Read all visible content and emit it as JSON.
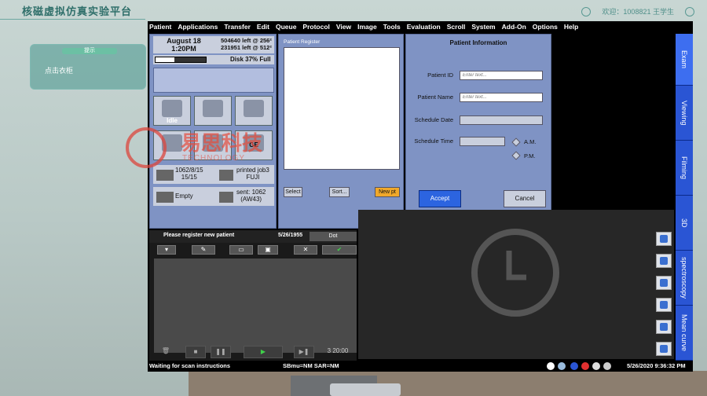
{
  "platform": {
    "title": "核磁虚拟仿真实验平台",
    "user_id": "1008821",
    "welcome": "欢迎：",
    "user_name": "王学生",
    "panel_tab": "提示",
    "panel_text": "点击衣柜"
  },
  "menu": [
    "Patient",
    "Applications",
    "Transfer",
    "Edit",
    "Queue",
    "Protocol",
    "View",
    "Image",
    "Tools",
    "Evaluation",
    "Scroll",
    "System",
    "Add-On",
    "Options",
    "Help"
  ],
  "status": {
    "date": "August 18",
    "time": "1:20PM",
    "space1": "504640 left @ 256²",
    "space2": "231951 left @ 512²",
    "disk_label": "Disk 37% Full",
    "disk_percent": 37,
    "idle_label": "Idle",
    "ge_label": "GE",
    "row1_left": "1062/8/15",
    "row1_left2": "15/15",
    "row1_right": "printed job3",
    "row1_right2": "FUJI",
    "row2_left": "Empty",
    "row2_right": "sent: 1062",
    "row2_right2": "(AW43)"
  },
  "register": {
    "title": "Patient Register",
    "select_label": "Select",
    "sort_label": "Sort...",
    "newpt_label": "New pt"
  },
  "patient_info": {
    "title": "Patient Information",
    "id_label": "Patient ID",
    "id_placeholder": "Enter text...",
    "name_label": "Patient Name",
    "name_placeholder": "Enter text...",
    "date_label": "Schedule Date",
    "time_label": "Schedule Time",
    "am_label": "A.M.",
    "pm_label": "P.M.",
    "accept_label": "Accept",
    "cancel_label": "Cancel"
  },
  "right_tabs": [
    "Exam",
    "Viewing",
    "Filming",
    "3D",
    "spectroscopy",
    "Mean curve"
  ],
  "scan": {
    "header": "Please register new patient",
    "date": "5/26/1955",
    "dot_label": "Dot",
    "timer": "3 20:00"
  },
  "statusbar": {
    "left": "Waiting  for scan instructions",
    "mid": "SBmu=NM SAR=NM",
    "datetime": "5/26/2020 9:36:32 PM"
  },
  "watermark": {
    "cn": "易思科技",
    "en": "TECHNOLOGY"
  },
  "colors": {
    "panel": "#7f93c4",
    "tab_blue": "#2a55d4",
    "accept_blue": "#2c64e0",
    "newpt_orange": "#f0a82a"
  }
}
